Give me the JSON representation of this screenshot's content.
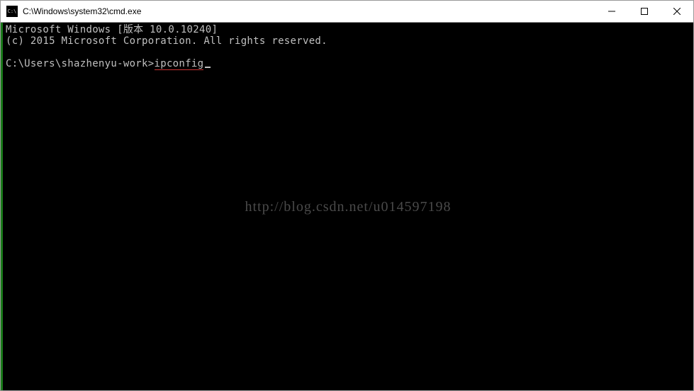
{
  "titlebar": {
    "title": "C:\\Windows\\system32\\cmd.exe"
  },
  "terminal": {
    "line1": "Microsoft Windows [版本 10.0.10240]",
    "line2": "(c) 2015 Microsoft Corporation. All rights reserved.",
    "prompt": "C:\\Users\\shazhenyu-work>",
    "command": "ipconfig"
  },
  "watermark": {
    "text": "http://blog.csdn.net/u014597198"
  }
}
